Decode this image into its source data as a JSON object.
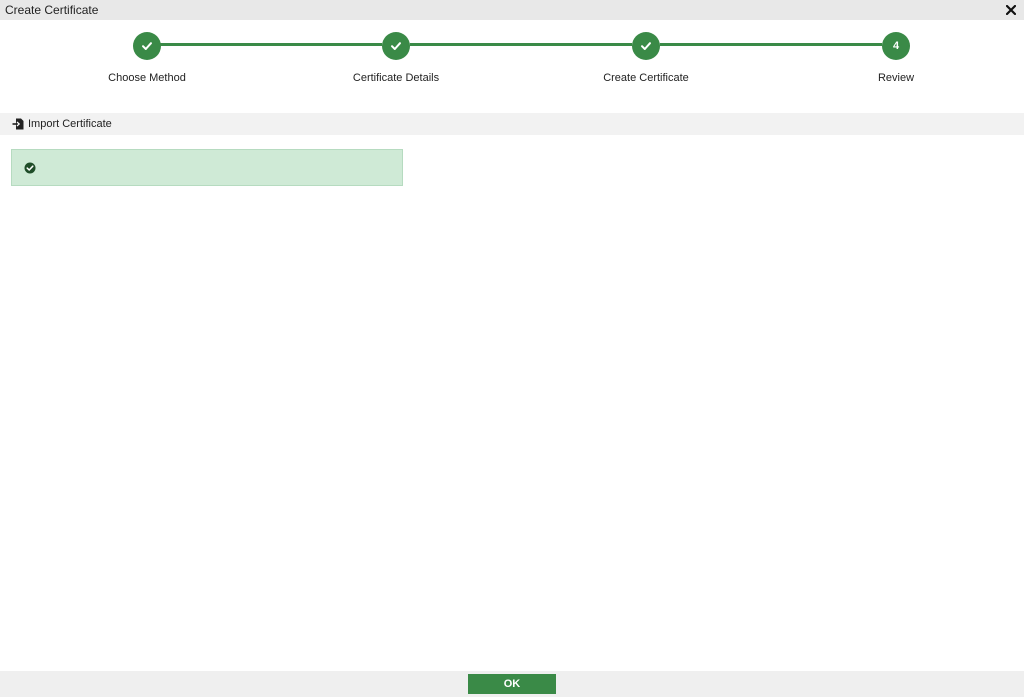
{
  "window": {
    "title": "Create Certificate",
    "close_icon": "close-icon"
  },
  "steps": [
    {
      "label": "Choose Method",
      "state": "done",
      "marker": ""
    },
    {
      "label": "Certificate Details",
      "state": "done",
      "marker": ""
    },
    {
      "label": "Create Certificate",
      "state": "done",
      "marker": ""
    },
    {
      "label": "Review",
      "state": "current",
      "marker": "4"
    }
  ],
  "section": {
    "title": "Import Certificate",
    "icon": "import-file-icon"
  },
  "message": {
    "text": "",
    "icon": "check-circle-icon"
  },
  "footer": {
    "ok_label": "OK"
  },
  "colors": {
    "accent": "#3a8a47",
    "success_bg": "#cfead6"
  }
}
